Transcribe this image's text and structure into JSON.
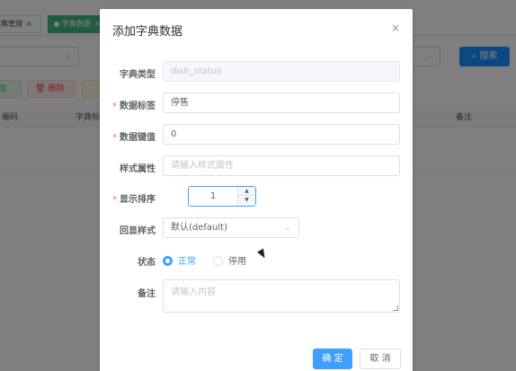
{
  "background": {
    "tabs": [
      {
        "label": "字典管理",
        "close": "×"
      },
      {
        "label": "字典数据",
        "close": "×"
      }
    ],
    "search_button": "搜索",
    "toolbar": {
      "add": "添加",
      "delete": "删除"
    },
    "table_headers": [
      "编码",
      "字典标",
      "备注"
    ]
  },
  "dialog": {
    "title": "添加字典数据",
    "close": "×",
    "fields": {
      "dict_type": {
        "label": "字典类型",
        "value": "dish_status"
      },
      "label": {
        "label": "数据标签",
        "value": "停售"
      },
      "value": {
        "label": "数据键值",
        "value": "0"
      },
      "css_class": {
        "label": "样式属性",
        "placeholder": "请输入样式属性"
      },
      "sort": {
        "label": "显示排序",
        "value": "1"
      },
      "list_class": {
        "label": "回显样式",
        "value": "默认(default)"
      },
      "status": {
        "label": "状态",
        "options": [
          "正常",
          "停用"
        ],
        "selected": "正常"
      },
      "remark": {
        "label": "备注",
        "placeholder": "请输入内容"
      }
    },
    "buttons": {
      "confirm": "确 定",
      "cancel": "取 消"
    }
  },
  "colors": {
    "primary": "#409eff",
    "required": "#f56c6c",
    "tag_active": "#42b983"
  }
}
